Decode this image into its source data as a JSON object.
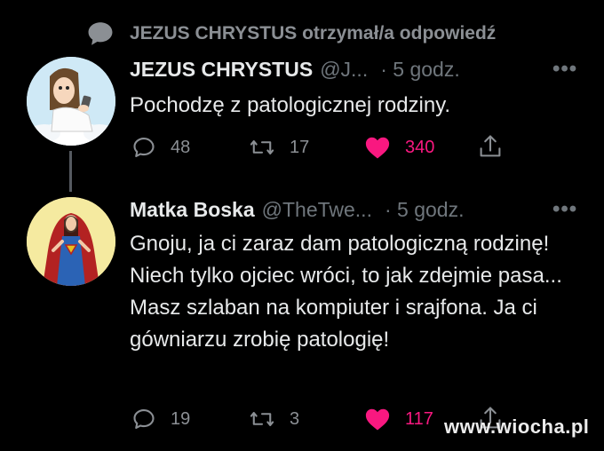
{
  "context": {
    "text": "JEZUS CHRYSTUS otrzymał/a odpowiedź"
  },
  "tweets": [
    {
      "name": "JEZUS CHRYSTUS",
      "handle": "@J...",
      "time": "· 5 godz.",
      "text": "Pochodzę z patologicznej rodziny.",
      "replies": "48",
      "retweets": "17",
      "likes": "340"
    },
    {
      "name": "Matka Boska",
      "handle": "@TheTwe...",
      "time": "· 5 godz.",
      "text": "Gnoju, ja ci zaraz dam patologiczną rodzinę! Niech tylko ojciec wróci, to jak zdejmie pasa... Masz szlaban na kompiuter i srajfona. Ja ci gówniarzu zrobię patologię!",
      "replies": "19",
      "retweets": "3",
      "likes": "117"
    }
  ],
  "more_glyph": "•••",
  "watermark": "www.wiocha.pl",
  "colors": {
    "background": "#000000",
    "text": "#e7e9ea",
    "muted": "#6f767c",
    "like": "#f91880"
  },
  "icons": [
    "speech-bubble-icon",
    "reply-icon",
    "retweet-icon",
    "heart-icon",
    "share-icon",
    "more-icon"
  ]
}
